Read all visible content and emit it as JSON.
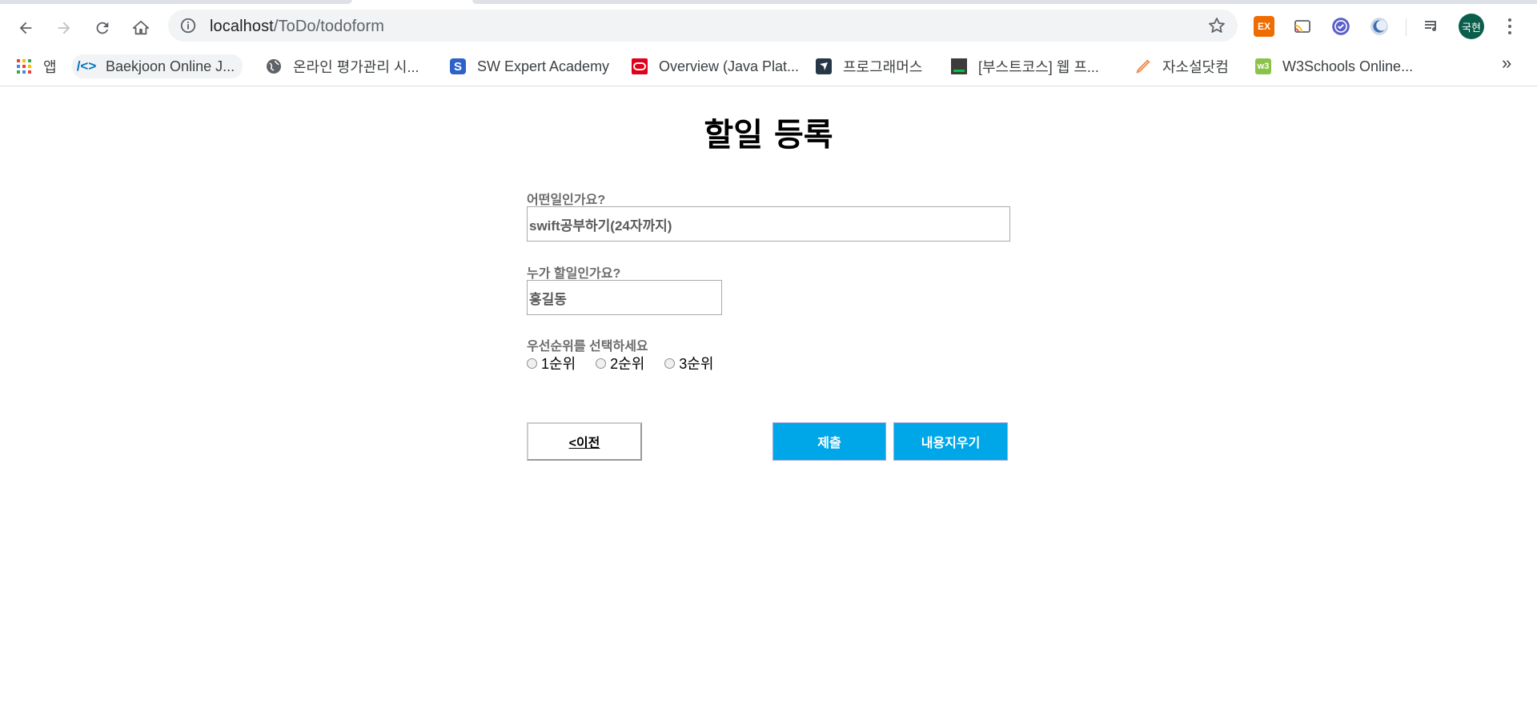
{
  "browser": {
    "url_host": "localhost",
    "url_path": "/ToDo/todoform",
    "profile_initials": "국현",
    "extensions": [
      "ex-extension-icon",
      "cast-icon",
      "check-circle-icon",
      "crescent-icon"
    ],
    "bookmarks": [
      {
        "label": "앱",
        "icon": "apps-grid-icon"
      },
      {
        "label": "Baekjoon Online J...",
        "icon": "code-brackets-icon"
      },
      {
        "label": "온라인 평가관리 시...",
        "icon": "globe-icon"
      },
      {
        "label": "SW Expert Academy",
        "icon": "s-logo-icon"
      },
      {
        "label": "Overview (Java Plat...",
        "icon": "oracle-icon"
      },
      {
        "label": "프로그래머스",
        "icon": "programmers-icon"
      },
      {
        "label": "[부스트코스] 웹 프...",
        "icon": "boostcourse-icon"
      },
      {
        "label": "자소설닷컴",
        "icon": "pencil-icon"
      },
      {
        "label": "W3Schools Online...",
        "icon": "w3-icon"
      }
    ],
    "more_label": "»"
  },
  "form": {
    "title": "할일 등록",
    "what_label": "어떤일인가요?",
    "what_placeholder": "swift공부하기(24자까지)",
    "who_label": "누가 할일인가요?",
    "who_placeholder": "홍길동",
    "priority_label": "우선순위를 선택하세요",
    "priorities": [
      "1순위",
      "2순위",
      "3순위"
    ],
    "prev_button": "<이전",
    "submit_button": "제출",
    "clear_button": "내용지우기"
  }
}
